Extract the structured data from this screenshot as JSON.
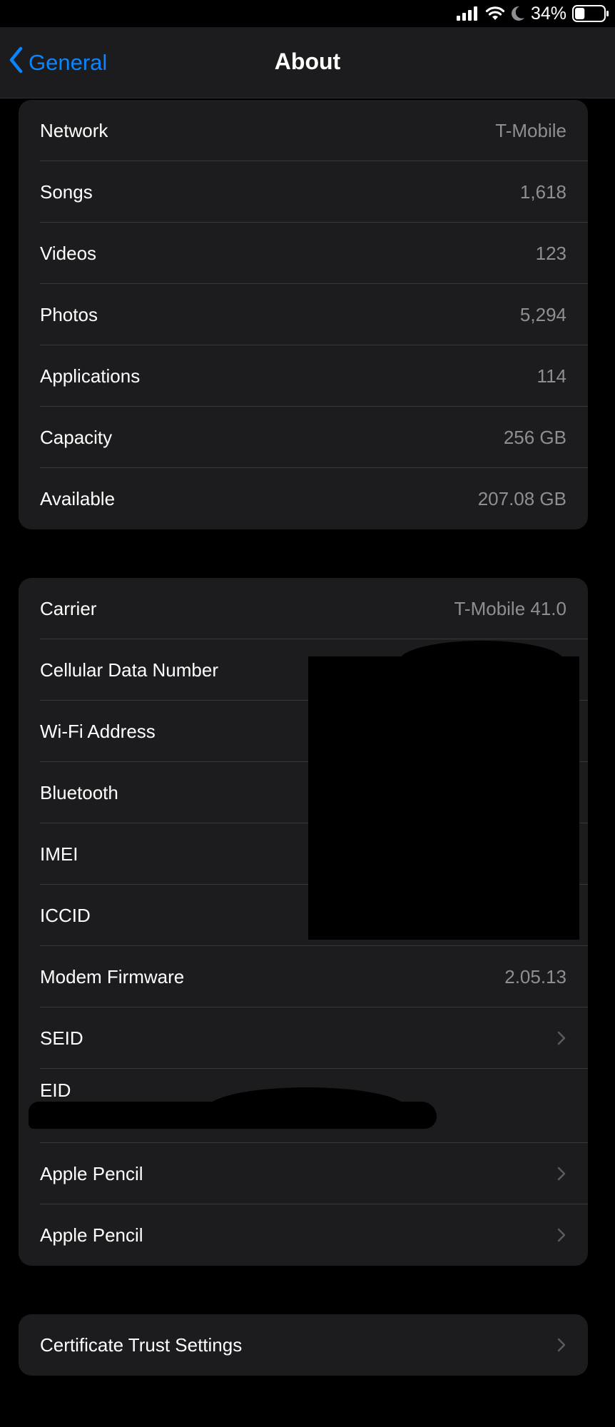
{
  "status_bar": {
    "battery_percent": "34%",
    "signal_icon": "cellular-signal-icon",
    "wifi_icon": "wifi-icon",
    "dnd_icon": "moon-icon",
    "battery_icon": "battery-icon",
    "battery_level": 0.34
  },
  "navbar": {
    "back_label": "General",
    "title": "About",
    "accent_color": "#0a84ff"
  },
  "groups": [
    {
      "rows": [
        {
          "label": "Network",
          "value": "T-Mobile"
        },
        {
          "label": "Songs",
          "value": "1,618"
        },
        {
          "label": "Videos",
          "value": "123"
        },
        {
          "label": "Photos",
          "value": "5,294"
        },
        {
          "label": "Applications",
          "value": "114"
        },
        {
          "label": "Capacity",
          "value": "256 GB"
        },
        {
          "label": "Available",
          "value": "207.08 GB"
        }
      ]
    },
    {
      "rows": [
        {
          "label": "Carrier",
          "value": "T-Mobile 41.0"
        },
        {
          "label": "Cellular Data Number",
          "value": ""
        },
        {
          "label": "Wi-Fi Address",
          "value": ""
        },
        {
          "label": "Bluetooth",
          "value": ""
        },
        {
          "label": "IMEI",
          "value": ""
        },
        {
          "label": "ICCID",
          "value": ""
        },
        {
          "label": "Modem Firmware",
          "value": "2.05.13"
        },
        {
          "label": "SEID",
          "chevron": true
        },
        {
          "label": "EID",
          "value": ""
        },
        {
          "label": "Apple Pencil",
          "chevron": true
        },
        {
          "label": "Apple Pencil",
          "chevron": true
        }
      ]
    },
    {
      "rows": [
        {
          "label": "Certificate Trust Settings",
          "chevron": true
        }
      ]
    }
  ]
}
